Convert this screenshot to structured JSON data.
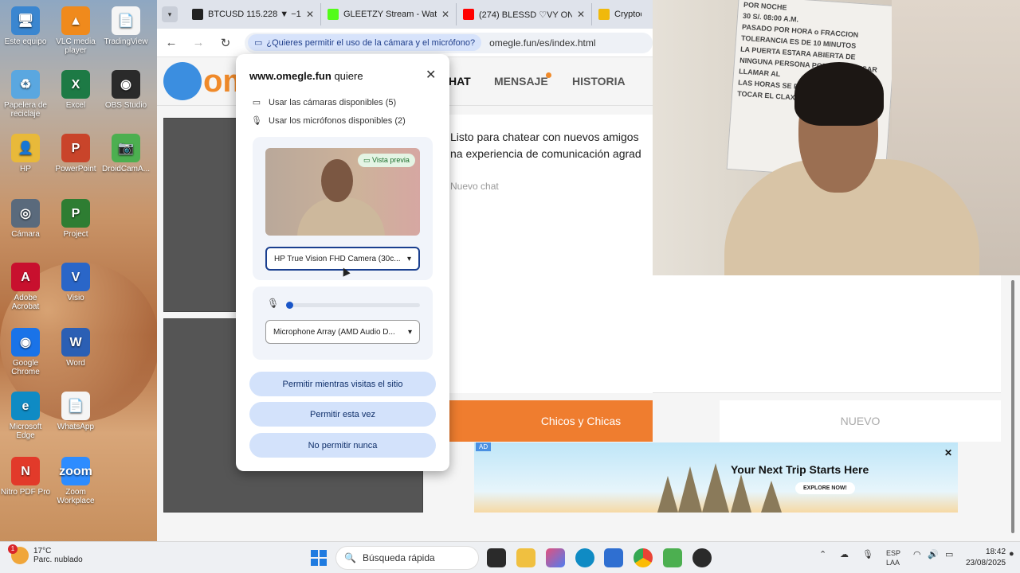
{
  "desktop": {
    "icons": [
      {
        "label": "Este equipo",
        "color": "#3a86d0",
        "glyph": "🖥"
      },
      {
        "label": "VLC media player",
        "color": "#f08a1c",
        "glyph": "▲"
      },
      {
        "label": "TradingView",
        "color": "#f5f5f5",
        "glyph": "📄"
      },
      {
        "label": "Papelera de reciclaje",
        "color": "#5aa7e0",
        "glyph": "♻"
      },
      {
        "label": "Excel",
        "color": "#1d7a45",
        "glyph": "X"
      },
      {
        "label": "OBS Studio",
        "color": "#2a2a2a",
        "glyph": "◉"
      },
      {
        "label": "HP",
        "color": "#e8b93a",
        "glyph": "👤"
      },
      {
        "label": "PowerPoint",
        "color": "#c9442a",
        "glyph": "P"
      },
      {
        "label": "DroidCamA...",
        "color": "#4caf50",
        "glyph": "📷"
      },
      {
        "label": "Cámara",
        "color": "#5a6a7c",
        "glyph": "◎"
      },
      {
        "label": "Project",
        "color": "#2e7d32",
        "glyph": "P"
      },
      {
        "label": "Adobe Acrobat",
        "color": "#c8102e",
        "glyph": "A"
      },
      {
        "label": "Visio",
        "color": "#2a66c8",
        "glyph": "V"
      },
      {
        "label": "Google Chrome",
        "color": "#1a73e8",
        "glyph": "◉"
      },
      {
        "label": "Word",
        "color": "#2b5fb4",
        "glyph": "W"
      },
      {
        "label": "Microsoft Edge",
        "color": "#0f8bc4",
        "glyph": "e"
      },
      {
        "label": "WhatsApp",
        "color": "#f5f5f5",
        "glyph": "📄"
      },
      {
        "label": "Nitro PDF Pro",
        "color": "#e23a2a",
        "glyph": "N"
      },
      {
        "label": "Zoom Workplace",
        "color": "#2d8cff",
        "glyph": "zoom"
      }
    ]
  },
  "browser": {
    "tabs": [
      {
        "label": "BTCUSD 115.228 ▼ −1.42",
        "color": "#222"
      },
      {
        "label": "GLEETZY Stream - Watch",
        "color": "#53fc18"
      },
      {
        "label": "(274) BLESSD ♡VY ON",
        "color": "#ff0000"
      },
      {
        "label": "Cryptocur",
        "color": "#f0b90b"
      }
    ],
    "permission_chip": "¿Quieres permitir el uso de la cámara y el micrófono?",
    "url": "omegle.fun/es/index.html"
  },
  "page": {
    "logo_text": "om",
    "nav": {
      "chat": "HAT",
      "message": "MENSAJE",
      "history": "HISTORIA"
    },
    "chat_lines": [
      "Listo para chatear con nuevos amigos",
      "na experiencia de comunicación agrad"
    ],
    "new_chat_placeholder": "Nuevo chat",
    "btn_gender": "Chicos y Chicas",
    "btn_new": "NUEVO"
  },
  "ad": {
    "badge": "AD",
    "title": "Your Next Trip Starts Here",
    "cta": "EXPLORE NOW!"
  },
  "dialog": {
    "site": "www.omegle.fun",
    "wants": "quiere",
    "perm_camera": "Usar las cámaras disponibles (5)",
    "perm_mic": "Usar los micrófonos disponibles (2)",
    "preview_badge": "Vista previa",
    "camera_select": "HP True Vision FHD Camera (30c...",
    "mic_level": 0.0,
    "mic_select": "Microphone Array (AMD Audio D...",
    "btn_allow_site": "Permitir mientras visitas el sitio",
    "btn_allow_once": "Permitir esta vez",
    "btn_never": "No permitir nunca"
  },
  "webcam_poster": [
    "POR NOCHE",
    "30 S/. 08:00 A.M.",
    "PASADO POR HORA o FRACCION",
    "TOLERANCIA ES DE 10 MINUTOS",
    "LA PUERTA ESTARA ABIERTA DE",
    "NINGUNA PERSONA PODRA INGRESAR",
    "LLAMAR AL",
    "LAS HORAS SE PAGA POR ADELANTADO",
    "TOCAR EL CLAXON"
  ],
  "taskbar": {
    "weather_temp": "17°C",
    "weather_desc": "Parc. nublado",
    "weather_badge": "1",
    "search": "Búsqueda rápida",
    "lang1": "ESP",
    "lang2": "LAA",
    "time": "18:42",
    "date": "23/08/2025"
  }
}
